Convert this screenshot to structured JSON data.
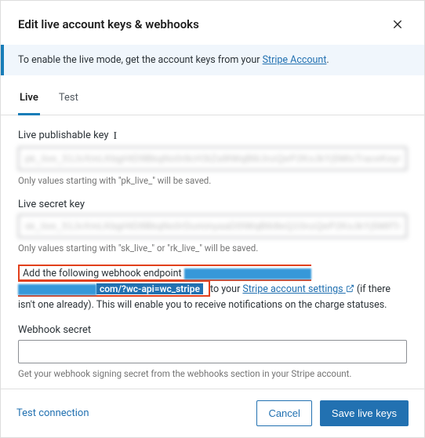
{
  "header": {
    "title": "Edit live account keys & webhooks"
  },
  "banner": {
    "text_pre": "To enable the live mode, get the account keys from your ",
    "link_text": "Stripe Account",
    "text_post": "."
  },
  "tabs": {
    "live": "Live",
    "test": "Test",
    "active": "live"
  },
  "fields": {
    "publishable": {
      "label": "Live publishable key",
      "value": "pk_live_51JvXmLKbgHtD9BkqNs0r8cH3tZa9lWqB6iJnzQeP2KoJkYj5MlxTraceKeyObf1XSo8J6w0DuD",
      "helper": "Only values starting with \"pk_live_\" will be saved."
    },
    "secret": {
      "label": "Live secret key",
      "value": "sk_live_51JvXmLKbgHtD9BkqNs0rDummyaaD0lWqB6i8eQ10nzQeP2KoJkYj5MlfTrsaDcdDtraceKey",
      "helper": "Only values starting with \"sk_live_\" or \"rk_live_\" will be saved."
    },
    "webhook_msg": {
      "pre": "Add the following webhook endpoint ",
      "url_visible": "com/?wc-api=wc_stripe",
      "mid": " to your ",
      "link": "Stripe account settings",
      "post": " (if there isn't one already). This will enable you to receive notifications on the charge statuses."
    },
    "webhook_secret": {
      "label": "Webhook secret",
      "value": "",
      "helper": "Get your webhook signing secret from the webhooks section in your Stripe account."
    }
  },
  "footer": {
    "test_connection": "Test connection",
    "cancel": "Cancel",
    "save": "Save live keys"
  }
}
